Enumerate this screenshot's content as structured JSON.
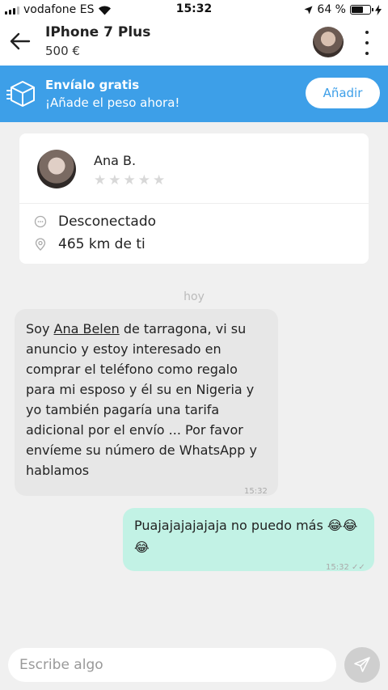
{
  "status_bar": {
    "carrier": "vodafone ES",
    "time": "15:32",
    "battery": "64 %",
    "battery_level": 0.64
  },
  "header": {
    "title": "IPhone 7 Plus",
    "price": "500 €"
  },
  "banner": {
    "title": "Envíalo gratis",
    "subtitle": "¡Añade el peso ahora!",
    "button_label": "Añadir"
  },
  "profile": {
    "name": "Ana B.",
    "rating_stars": 0,
    "rating_max": 5,
    "status": "Desconectado",
    "distance": "465 km de ti"
  },
  "chat": {
    "date_separator": "hoy",
    "messages": [
      {
        "direction": "incoming",
        "text_before": "Soy ",
        "link_text": "Ana Belen",
        "text_after": " de tarragona, vi su anuncio y estoy interesado en comprar el teléfono como regalo para mi esposo y él su en Nigeria y yo también pagaría una tarifa adicional por el envío ... Por favor envíeme su número de WhatsApp y hablamos",
        "time": "15:32"
      },
      {
        "direction": "outgoing",
        "text": "Puajajajajajaja no puedo más 😂😂😂",
        "time": "15:32"
      }
    ]
  },
  "composer": {
    "placeholder": "Escribe algo"
  },
  "colors": {
    "banner_bg": "#3d9fe8",
    "incoming_bubble": "#e7e7e7",
    "outgoing_bubble": "#c2f2e5",
    "background": "#f0f0f0"
  }
}
